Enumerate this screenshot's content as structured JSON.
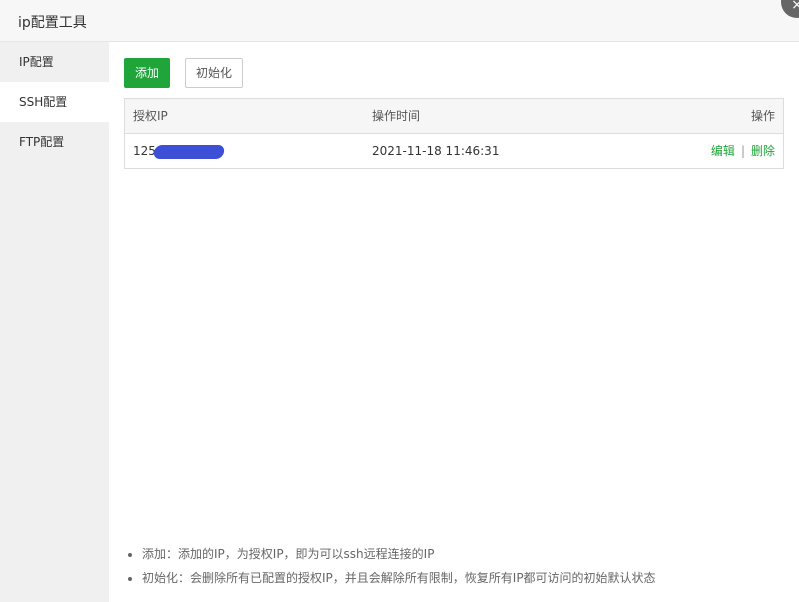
{
  "window": {
    "title": "ip配置工具",
    "close_symbol": "×"
  },
  "sidebar": {
    "items": [
      {
        "label": "IP配置",
        "active": false
      },
      {
        "label": "SSH配置",
        "active": true
      },
      {
        "label": "FTP配置",
        "active": false
      }
    ]
  },
  "toolbar": {
    "add_label": "添加",
    "init_label": "初始化"
  },
  "table": {
    "headers": [
      "授权IP",
      "操作时间",
      "操作"
    ],
    "rows": [
      {
        "ip": "125",
        "time": "2021-11-18 11:46:31",
        "edit": "编辑",
        "separator": "|",
        "delete": "删除"
      }
    ]
  },
  "notes": [
    "添加：添加的IP，为授权IP，即为可以ssh远程连接的IP",
    "初始化：会删除所有已配置的授权IP，并且会解除所有限制，恢复所有IP都可访问的初始默认状态"
  ],
  "colors": {
    "accent": "#20a53a",
    "sidebar_bg": "#f0f0f0",
    "redaction": "#3c4fd6"
  }
}
